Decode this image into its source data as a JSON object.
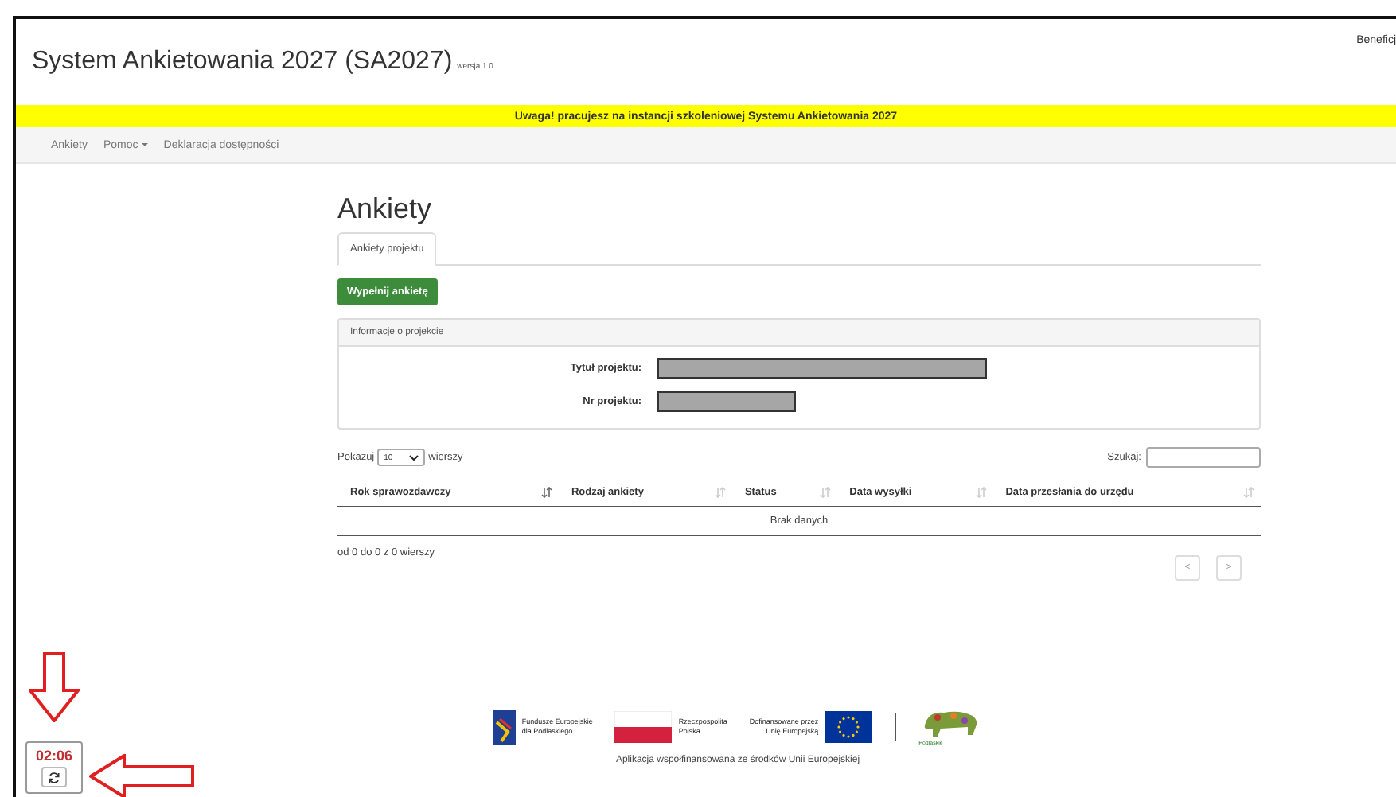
{
  "header": {
    "title": "System Ankietowania 2027 (SA2027)",
    "version": "wersja 1.0",
    "user": "Beneficj"
  },
  "notice": "Uwaga! pracujesz na instancji szkoleniowej Systemu Ankietowania 2027",
  "nav": [
    {
      "label": "Ankiety",
      "dropdown": false
    },
    {
      "label": "Pomoc",
      "dropdown": true
    },
    {
      "label": "Deklaracja dostępności",
      "dropdown": false
    }
  ],
  "page": {
    "heading": "Ankiety",
    "tabs": [
      {
        "label": "Ankiety projektu",
        "selected": true
      }
    ],
    "action_button": "Wypełnij ankietę"
  },
  "project_panel": {
    "title": "Informacje o projekcie",
    "fields": [
      {
        "label": "Tytuł projektu:",
        "kind": "long"
      },
      {
        "label": "Nr projektu:",
        "kind": "short"
      }
    ]
  },
  "table": {
    "length_before": "Pokazuj",
    "length_value": "10",
    "length_after": "wierszy",
    "search_label": "Szukaj:",
    "columns": [
      {
        "label": "Rok sprawozdawczy",
        "sorted": true
      },
      {
        "label": "Rodzaj ankiety",
        "sorted": false
      },
      {
        "label": "Status",
        "sorted": false
      },
      {
        "label": "Data wysyłki",
        "sorted": false
      },
      {
        "label": "Data przesłania do urzędu",
        "sorted": false
      }
    ],
    "empty_message": "Brak danych",
    "info": "od 0 do 0 z 0 wierszy",
    "pagination": [
      "<",
      ">"
    ]
  },
  "footer": {
    "logos": [
      {
        "kind": "fe",
        "lines": [
          "Fundusze Europejskie",
          "dla Podlaskiego"
        ]
      },
      {
        "kind": "flag",
        "lines": [
          "Rzeczpospolita",
          "Polska"
        ]
      },
      {
        "kind": "eu",
        "lines": [
          "Dofinansowane przez",
          "Unię Europejską"
        ]
      },
      {
        "kind": "region",
        "lines": [
          "Podlaskie"
        ]
      }
    ],
    "caption": "Aplikacja współfinansowana ze środków Unii Europejskiej"
  },
  "timer": {
    "time": "02:06"
  }
}
